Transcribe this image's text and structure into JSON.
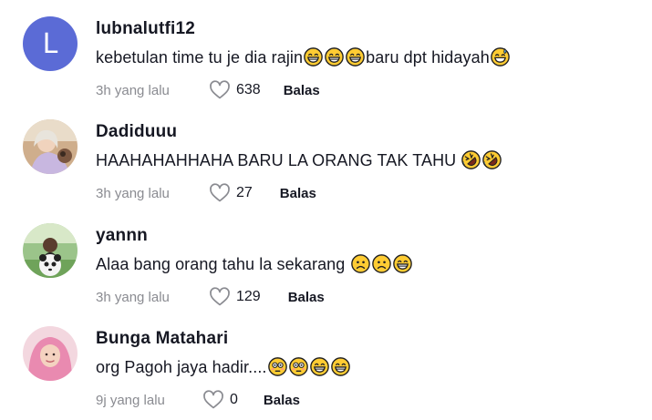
{
  "comments": [
    {
      "username": "lubnalutfi12",
      "avatar_letter": "L",
      "text_parts": [
        "kebetulan time tu je dia rajin",
        "baru dpt hidayah"
      ],
      "time": "3h yang lalu",
      "likes": "638",
      "reply_label": "Balas"
    },
    {
      "username": "Dadiduuu",
      "text_parts": [
        "HAAHAHAHHAHA BARU LA ORANG TAK TAHU "
      ],
      "time": "3h yang lalu",
      "likes": "27",
      "reply_label": "Balas"
    },
    {
      "username": "yannn",
      "text_parts": [
        "Alaa bang orang tahu la sekarang "
      ],
      "time": "3h yang lalu",
      "likes": "129",
      "reply_label": "Balas"
    },
    {
      "username": "Bunga Matahari",
      "text_parts": [
        "org Pagoh jaya hadir...."
      ],
      "time": "9j yang lalu",
      "likes": "0",
      "reply_label": "Balas"
    }
  ],
  "colors": {
    "letter_avatar_bg": "#5b6bd6",
    "secondary_text": "#8a8b91",
    "primary_text": "#161823",
    "emoji_yellow": "#ffcc33"
  },
  "icons": {
    "like": "heart-outline-icon",
    "emojis": [
      "grinning-sweat-emoji",
      "rolling-laughing-emoji",
      "sad-emoji",
      "flushed-emoji"
    ]
  }
}
